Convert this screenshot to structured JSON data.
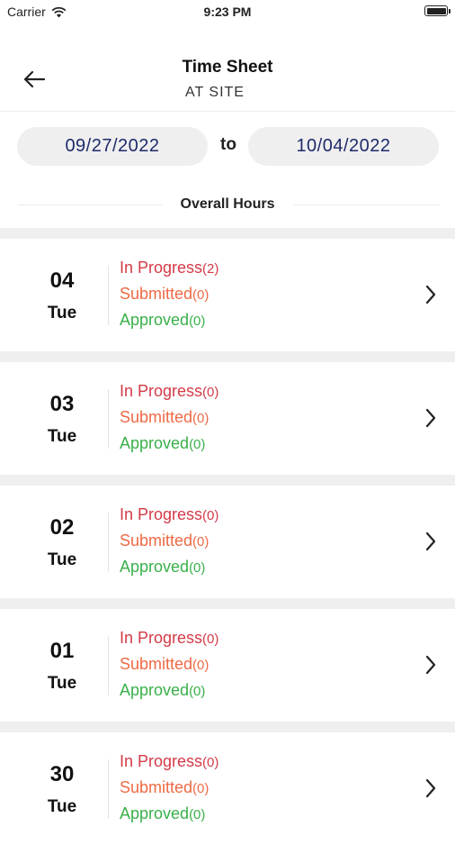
{
  "status_bar": {
    "carrier": "Carrier",
    "time": "9:23 PM"
  },
  "header": {
    "title": "Time Sheet",
    "subtitle": "AT SITE"
  },
  "date_range": {
    "from": "09/27/2022",
    "separator": "to",
    "to": "10/04/2022"
  },
  "overall_hours_label": "Overall Hours",
  "colors": {
    "in_progress": "#d43a47",
    "submitted": "#ee6a45",
    "approved": "#39b04a",
    "date_text": "#1f2a6b"
  },
  "days": [
    {
      "day": "04",
      "weekday": "Tue",
      "in_progress_label": "In Progress",
      "in_progress_count": "(2)",
      "submitted_label": "Submitted",
      "submitted_count": "(0)",
      "approved_label": "Approved",
      "approved_count": "(0)"
    },
    {
      "day": "03",
      "weekday": "Tue",
      "in_progress_label": "In Progress",
      "in_progress_count": "(0)",
      "submitted_label": "Submitted",
      "submitted_count": "(0)",
      "approved_label": "Approved",
      "approved_count": "(0)"
    },
    {
      "day": "02",
      "weekday": "Tue",
      "in_progress_label": "In Progress",
      "in_progress_count": "(0)",
      "submitted_label": "Submitted",
      "submitted_count": "(0)",
      "approved_label": "Approved",
      "approved_count": "(0)"
    },
    {
      "day": "01",
      "weekday": "Tue",
      "in_progress_label": "In Progress",
      "in_progress_count": "(0)",
      "submitted_label": "Submitted",
      "submitted_count": "(0)",
      "approved_label": "Approved",
      "approved_count": "(0)"
    },
    {
      "day": "30",
      "weekday": "Tue",
      "in_progress_label": "In Progress",
      "in_progress_count": "(0)",
      "submitted_label": "Submitted",
      "submitted_count": "(0)",
      "approved_label": "Approved",
      "approved_count": "(0)"
    }
  ]
}
